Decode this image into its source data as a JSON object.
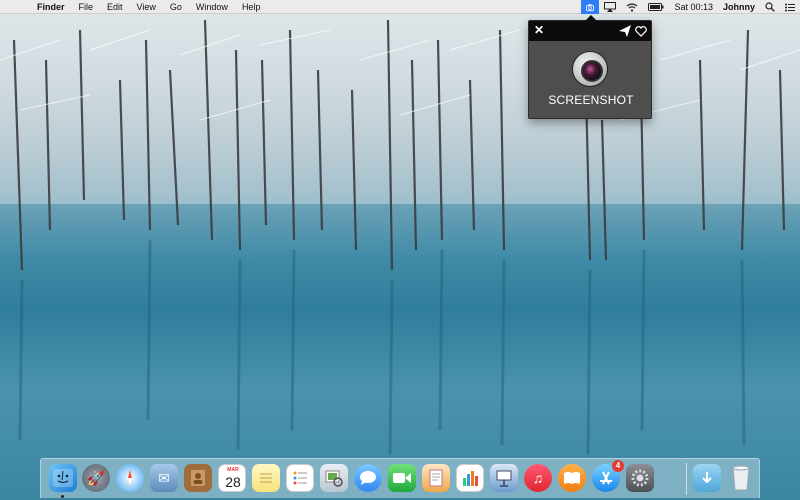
{
  "menubar": {
    "app_name": "Finder",
    "menus": [
      "File",
      "Edit",
      "View",
      "Go",
      "Window",
      "Help"
    ],
    "clock": "Sat 00:13",
    "user": "Johnny"
  },
  "popup": {
    "label": "SCREENSHOT",
    "close_icon": "close-icon",
    "send_icon": "send-icon",
    "heart_icon": "heart-icon"
  },
  "dock": {
    "apps": [
      {
        "name": "Finder",
        "icon": "finder-icon"
      },
      {
        "name": "Launchpad",
        "icon": "launchpad-icon"
      },
      {
        "name": "Safari",
        "icon": "safari-icon"
      },
      {
        "name": "Mail",
        "icon": "mail-icon"
      },
      {
        "name": "Contacts",
        "icon": "contacts-icon"
      },
      {
        "name": "Calendar",
        "icon": "calendar-icon"
      },
      {
        "name": "Notes",
        "icon": "notes-icon"
      },
      {
        "name": "Reminders",
        "icon": "reminders-icon"
      },
      {
        "name": "Preview",
        "icon": "preview-icon"
      },
      {
        "name": "Messages",
        "icon": "messages-icon"
      },
      {
        "name": "FaceTime",
        "icon": "facetime-icon"
      },
      {
        "name": "Pages",
        "icon": "pages-icon"
      },
      {
        "name": "Numbers",
        "icon": "numbers-icon"
      },
      {
        "name": "Keynote",
        "icon": "keynote-icon"
      },
      {
        "name": "iTunes",
        "icon": "itunes-icon"
      },
      {
        "name": "iBooks",
        "icon": "ibooks-icon"
      },
      {
        "name": "App Store",
        "icon": "appstore-icon"
      },
      {
        "name": "System Preferences",
        "icon": "system-preferences-icon"
      },
      {
        "name": "Downloads",
        "icon": "downloads-folder-icon"
      },
      {
        "name": "Trash",
        "icon": "trash-icon"
      }
    ],
    "calendar_month": "MAR",
    "calendar_day": "28",
    "appstore_badge": "4"
  }
}
